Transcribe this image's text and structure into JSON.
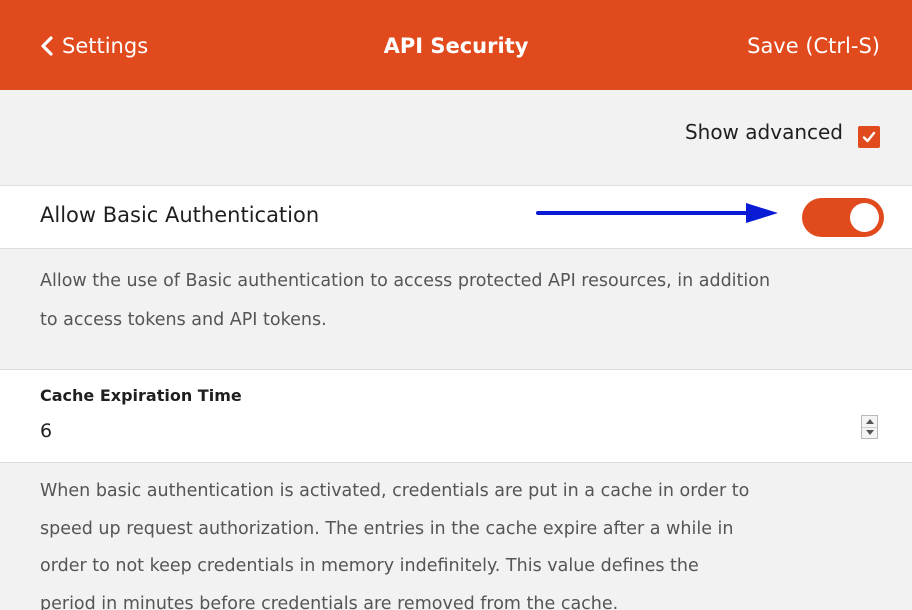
{
  "header": {
    "back_label": "Settings",
    "title": "API Security",
    "save_label": "Save (Ctrl-S)"
  },
  "advanced": {
    "label": "Show advanced",
    "checked": true
  },
  "basic_auth": {
    "label": "Allow Basic Authentication",
    "enabled": true,
    "description": "Allow the use of Basic authentication to access protected API resources, in addition\nto access tokens and API tokens."
  },
  "cache_expiration": {
    "label": "Cache Expiration Time",
    "value": "6",
    "description": "When basic authentication is activated, credentials are put in a cache in order to\nspeed up request authorization. The entries in the cache expire after a while in\norder to not keep credentials in memory indefinitely. This value defines the\nperiod in minutes before credentials are removed from the cache."
  },
  "colors": {
    "accent": "#e14a1c",
    "annotation_arrow": "#0a1bd6"
  },
  "icons": {
    "back": "chevron-left-icon",
    "check": "checkmark-icon",
    "spin_up": "triangle-up-icon",
    "spin_down": "triangle-down-icon"
  }
}
